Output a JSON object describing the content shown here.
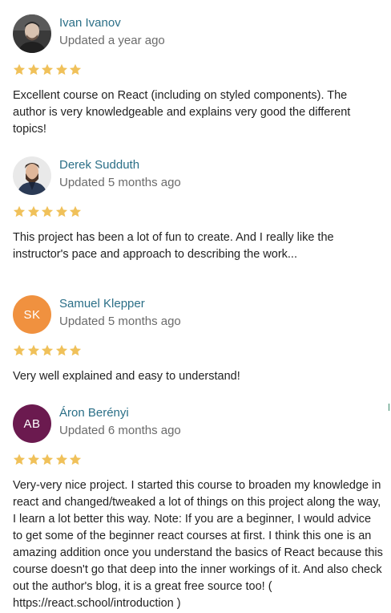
{
  "colors": {
    "name_link": "#2b6f87",
    "meta_text": "#6b6b6b",
    "body_text": "#222222",
    "star": "#f0c15a",
    "avatar_sk": "#f0913f",
    "avatar_ab": "#6b1a4f"
  },
  "reviews": [
    {
      "name": "Ivan Ivanov",
      "updated": "Updated a year ago",
      "rating": 5,
      "avatar_type": "photo",
      "text": "Excellent course on React (including on styled components). The author is very knowledgeable and explains very good the different topics!"
    },
    {
      "name": "Derek Sudduth",
      "updated": "Updated 5 months ago",
      "rating": 5,
      "avatar_type": "photo",
      "text": "This project has been a lot of fun to create. And I really like the instructor's pace and approach to describing the work..."
    },
    {
      "name": "Samuel Klepper",
      "updated": "Updated 5 months ago",
      "rating": 5,
      "avatar_initials": "SK",
      "text": "Very well explained and easy to understand!"
    },
    {
      "name": "Áron Berényi",
      "updated": "Updated 6 months ago",
      "rating": 5,
      "avatar_initials": "AB",
      "text": "Very-very nice project. I started this course to broaden my knowledge in react and changed/tweaked a lot of things on this project along the way, I learn a lot better this way. Note: If you are a beginner, I would advice to get some of the beginner react courses at first. I think this one is an amazing addition once you understand the basics of React because this course doesn't go that deep into the inner workings of it. And also check out the author's blog, it is a great free source too! ( https://react.school/introduction )"
    }
  ]
}
